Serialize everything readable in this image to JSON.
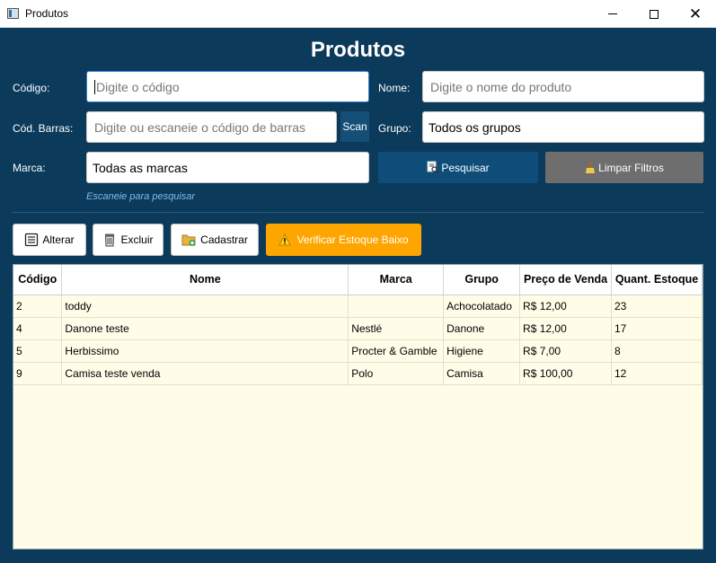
{
  "window": {
    "title": "Produtos",
    "controls": {
      "minimize": "",
      "maximize": "",
      "close": "✕"
    }
  },
  "header": {
    "title": "Produtos"
  },
  "filters": {
    "codigo": {
      "label": "Código:",
      "placeholder": "Digite o código"
    },
    "nome": {
      "label": "Nome:",
      "placeholder": "Digite o nome do produto"
    },
    "cod_barras": {
      "label": "Cód. Barras:",
      "placeholder": "Digite ou escaneie o código de barras",
      "scan_label": "Scan"
    },
    "grupo": {
      "label": "Grupo:",
      "value": "Todos os grupos"
    },
    "marca": {
      "label": "Marca:",
      "value": "Todas as marcas"
    },
    "pesquisar_label": "Pesquisar",
    "limpar_label": "Limpar Filtros",
    "hint": "Escaneie para pesquisar"
  },
  "actions": {
    "alterar": "Alterar",
    "excluir": "Excluir",
    "cadastrar": "Cadastrar",
    "verificar": "Verificar Estoque Baixo"
  },
  "table": {
    "headers": [
      "Código",
      "Nome",
      "Marca",
      "Grupo",
      "Preço de Venda",
      "Quant. Estoque"
    ],
    "rows": [
      [
        "2",
        "toddy",
        "",
        "Achocolatado",
        "R$ 12,00",
        "23"
      ],
      [
        "4",
        "Danone teste",
        "Nestlé",
        "Danone",
        "R$ 12,00",
        "17"
      ],
      [
        "5",
        "Herbissimo",
        "Procter & Gamble",
        "Higiene",
        "R$ 7,00",
        "8"
      ],
      [
        "9",
        "Camisa teste venda",
        "Polo",
        "Camisa",
        "R$ 100,00",
        "12"
      ]
    ]
  },
  "colors": {
    "background": "#0b3a5b",
    "warning": "#ffa500",
    "table_bg": "#fffde8",
    "clear_button": "#6e6e6e"
  },
  "icons": [
    "app-window-icon",
    "document-icon",
    "trash-icon",
    "folder-add-icon",
    "warning-icon",
    "search-icon",
    "broom-icon"
  ]
}
